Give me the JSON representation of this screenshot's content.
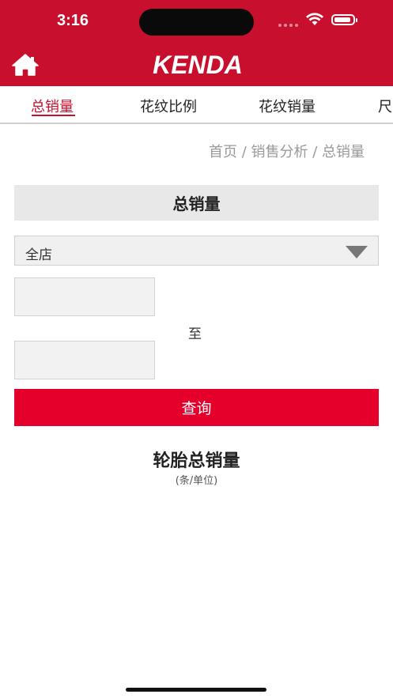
{
  "status_bar": {
    "time": "3:16"
  },
  "header": {
    "logo_text": "KENDA",
    "brand_color": "#c8102e"
  },
  "tabs": [
    {
      "label": "总销量",
      "active": true
    },
    {
      "label": "花纹比例",
      "active": false
    },
    {
      "label": "花纹销量",
      "active": false
    },
    {
      "label": "尺",
      "active": false
    }
  ],
  "breadcrumb": "首页 / 销售分析 / 总销量",
  "section_title": "总销量",
  "store_select": {
    "value": "全店"
  },
  "date_range": {
    "start": "",
    "end": "",
    "separator": "至"
  },
  "query_button": {
    "label": "查询",
    "color": "#e4002b"
  },
  "chart": {
    "title": "轮胎总销量",
    "unit": "(条/单位)"
  }
}
